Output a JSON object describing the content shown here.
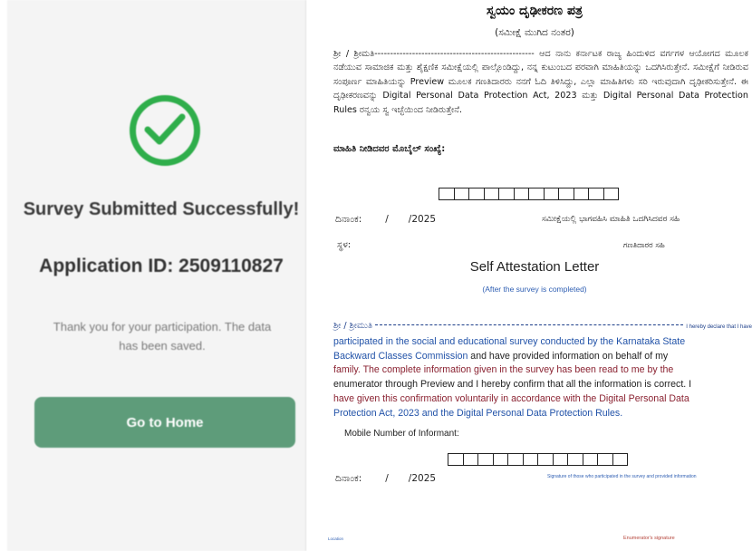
{
  "phone": {
    "title": "Survey Submitted Successfully!",
    "application_id": "Application ID: 2509110827",
    "thanks_message": "Thank you for your participation. The data has been saved.",
    "home_button": "Go to Home",
    "check_icon": "check-circle-icon",
    "accent_color": "#2fae4b",
    "button_color": "#5e9c7a"
  },
  "kannada": {
    "title": "ಸ್ವಯಂ ದೃಢೀಕರಣ ಪತ್ರ",
    "subtitle": "(ಸಮೀಕ್ಷೆ ಮುಗಿದ ನಂತರ)",
    "paragraph": "ಶ್ರೀ / ಶ್ರೀಮತಿ--------------------------------------------------- ಆದ ನಾನು ಕರ್ನಾಟಕ ರಾಜ್ಯ ಹಿಂದುಳಿದ ವರ್ಗಗಳ ಆಯೋಗದ ಮೂಲಕ ನಡೆಯುವ ಸಾಮಾಜಿಕ ಮತ್ತು ಶೈಕ್ಷಣಿಕ ಸಮೀಕ್ಷೆಯಲ್ಲಿ ಪಾಲ್ಗೊಂಡಿದ್ದು, ನನ್ನ ಕುಟುಂಬದ ಪರವಾಗಿ ಮಾಹಿತಿಯನ್ನು ಒದಗಿಸಿರುತ್ತೇನೆ. ಸಮೀಕ್ಷೆಗೆ ನೀಡಿರುವ ಸಂಪೂರ್ಣ ಮಾಹಿತಿಯನ್ನು Preview ಮೂಲಕ ಗಣತಿದಾರರು ನನಗೆ ಓದಿ ತಿಳಿಸಿದ್ದು, ಎಲ್ಲಾ ಮಾಹಿತಿಗಳು ಸರಿ ಇರುವುದಾಗಿ ದೃಢೀಕರಿಸುತ್ತೇನೆ. ಈ ದೃಢೀಕರಣವನ್ನು Digital Personal Data Protection Act, 2023 ಮತ್ತು Digital Personal Data Protection Rules ರನ್ವಯ ಸ್ವ ಇಚ್ಛೆಯಿಂದ ನೀಡಿರುತ್ತೇನೆ.",
    "mobile_label": "ಮಾಹಿತಿ ನೀಡಿದವರ ಮೊಬೈಲ್ ಸಂಖ್ಯೆ:",
    "date_label": "ದಿನಾಂಕ:",
    "date_slash": "/",
    "year": "/2025",
    "participant_sig": "ಸಮೀಕ್ಷೆಯಲ್ಲಿ ಭಾಗವಹಿಸಿ ಮಾಹಿತಿ ಒದಗಿಸಿದವರ ಸಹಿ",
    "place_label": "ಸ್ಥಳ:",
    "enumerator_sig": "ಗಣತಿದಾರರ ಸಹಿ"
  },
  "english": {
    "title": "Self Attestation Letter",
    "subtitle": "(After the survey is completed)",
    "line0_kannada": "ಶ್ರೀ / ಶ್ರೀಮುತಿ",
    "line0_tail": "I hereby declare that I have",
    "line1": "participated in the social and educational survey conducted by the Karnataka State",
    "line2_a": "Backward Classes Commission",
    "line2_b": " and have provided information on behalf of my",
    "line3": "family. The complete information given in the survey has been read to me by the",
    "line4": "enumerator through Preview and I hereby confirm that all the information is correct. I",
    "line5_a": "have given this confirmation voluntarily in accordance with the Digital Personal Data",
    "line6": "Protection Act, 2023 and the Digital Personal Data Protection Rules.",
    "mobile_label": "Mobile Number of Informant:",
    "date_label": "ದಿನಾಂಕ:",
    "date_slash": "/",
    "year": "/2025",
    "participant_sig": "Signature of those who participated in the survey and provided information",
    "footer_left": "Location",
    "footer_right": "Enumerator's signature"
  }
}
